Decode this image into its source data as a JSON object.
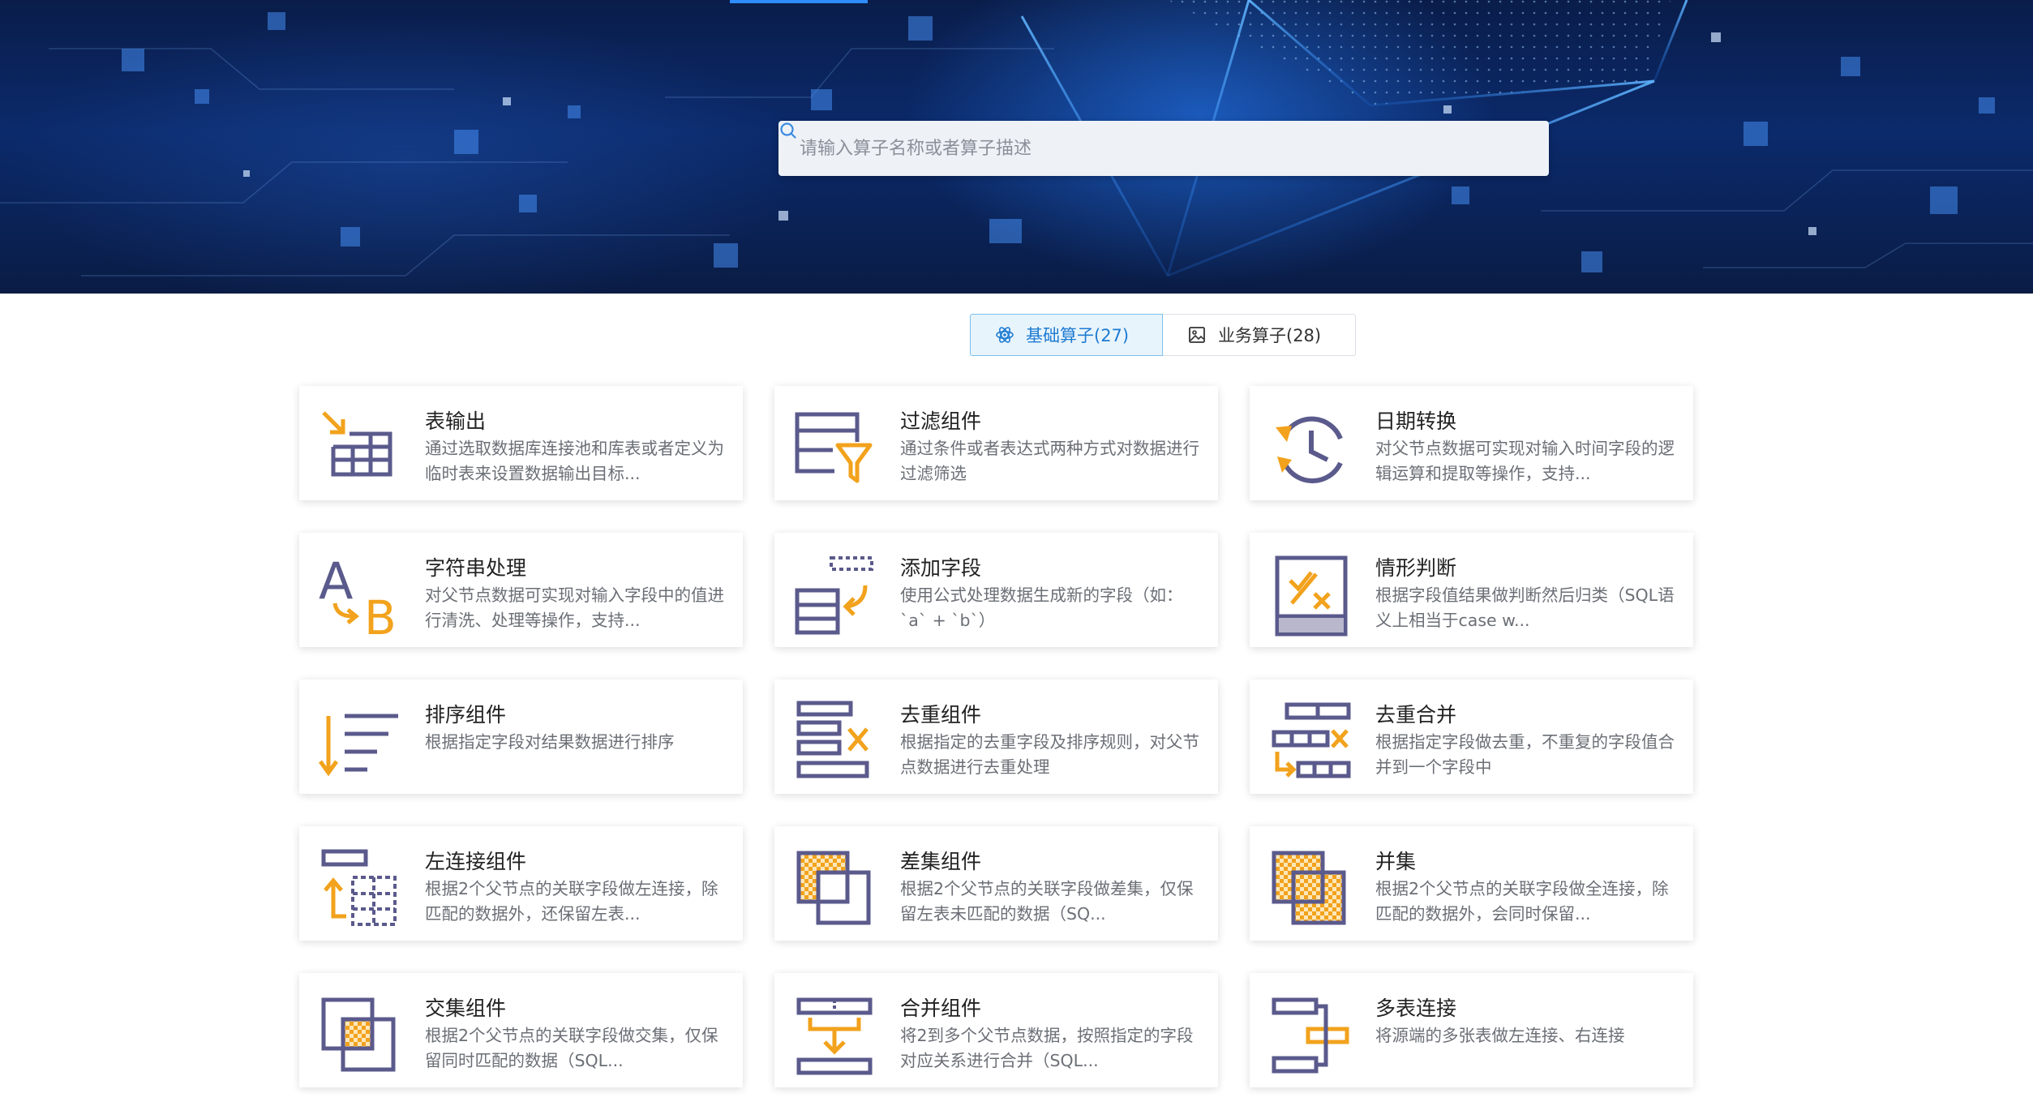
{
  "search": {
    "placeholder": "请输入算子名称或者算子描述"
  },
  "tabs": [
    {
      "label": "基础算子(27)",
      "active": true,
      "icon": "atom-icon"
    },
    {
      "label": "业务算子(28)",
      "active": false,
      "icon": "image-icon"
    }
  ],
  "colors": {
    "accent": "#1e7bd2",
    "icon_purple": "#5b5a8c",
    "icon_orange": "#f2a21c"
  },
  "cards": [
    {
      "title": "表输出",
      "desc": "通过选取数据库连接池和库表或者定义为临时表来设置数据输出目标...",
      "icon": "table-output-icon"
    },
    {
      "title": "过滤组件",
      "desc": "通过条件或者表达式两种方式对数据进行过滤筛选",
      "icon": "filter-icon"
    },
    {
      "title": "日期转换",
      "desc": "对父节点数据可实现对输入时间字段的逻辑运算和提取等操作，支持...",
      "icon": "date-convert-icon"
    },
    {
      "title": "字符串处理",
      "desc": "对父节点数据可实现对输入字段中的值进行清洗、处理等操作，支持...",
      "icon": "string-process-icon"
    },
    {
      "title": "添加字段",
      "desc": "使用公式处理数据生成新的字段（如：`a` + `b`）",
      "icon": "add-field-icon"
    },
    {
      "title": "情形判断",
      "desc": "根据字段值结果做判断然后归类（SQL语义上相当于case w...",
      "icon": "case-judge-icon"
    },
    {
      "title": "排序组件",
      "desc": "根据指定字段对结果数据进行排序",
      "icon": "sort-icon"
    },
    {
      "title": "去重组件",
      "desc": "根据指定的去重字段及排序规则，对父节点数据进行去重处理",
      "icon": "dedupe-icon"
    },
    {
      "title": "去重合并",
      "desc": "根据指定字段做去重，不重复的字段值合并到一个字段中",
      "icon": "dedupe-merge-icon"
    },
    {
      "title": "左连接组件",
      "desc": "根据2个父节点的关联字段做左连接，除匹配的数据外，还保留左表...",
      "icon": "left-join-icon"
    },
    {
      "title": "差集组件",
      "desc": "根据2个父节点的关联字段做差集，仅保留左表未匹配的数据（SQ...",
      "icon": "difference-icon"
    },
    {
      "title": "并集",
      "desc": "根据2个父节点的关联字段做全连接，除匹配的数据外，会同时保留...",
      "icon": "union-icon"
    },
    {
      "title": "交集组件",
      "desc": "根据2个父节点的关联字段做交集，仅保留同时匹配的数据（SQL...",
      "icon": "intersection-icon"
    },
    {
      "title": "合并组件",
      "desc": "将2到多个父节点数据，按照指定的字段对应关系进行合并（SQL...",
      "icon": "merge-icon"
    },
    {
      "title": "多表连接",
      "desc": "将源端的多张表做左连接、右连接",
      "icon": "multi-join-icon"
    }
  ]
}
